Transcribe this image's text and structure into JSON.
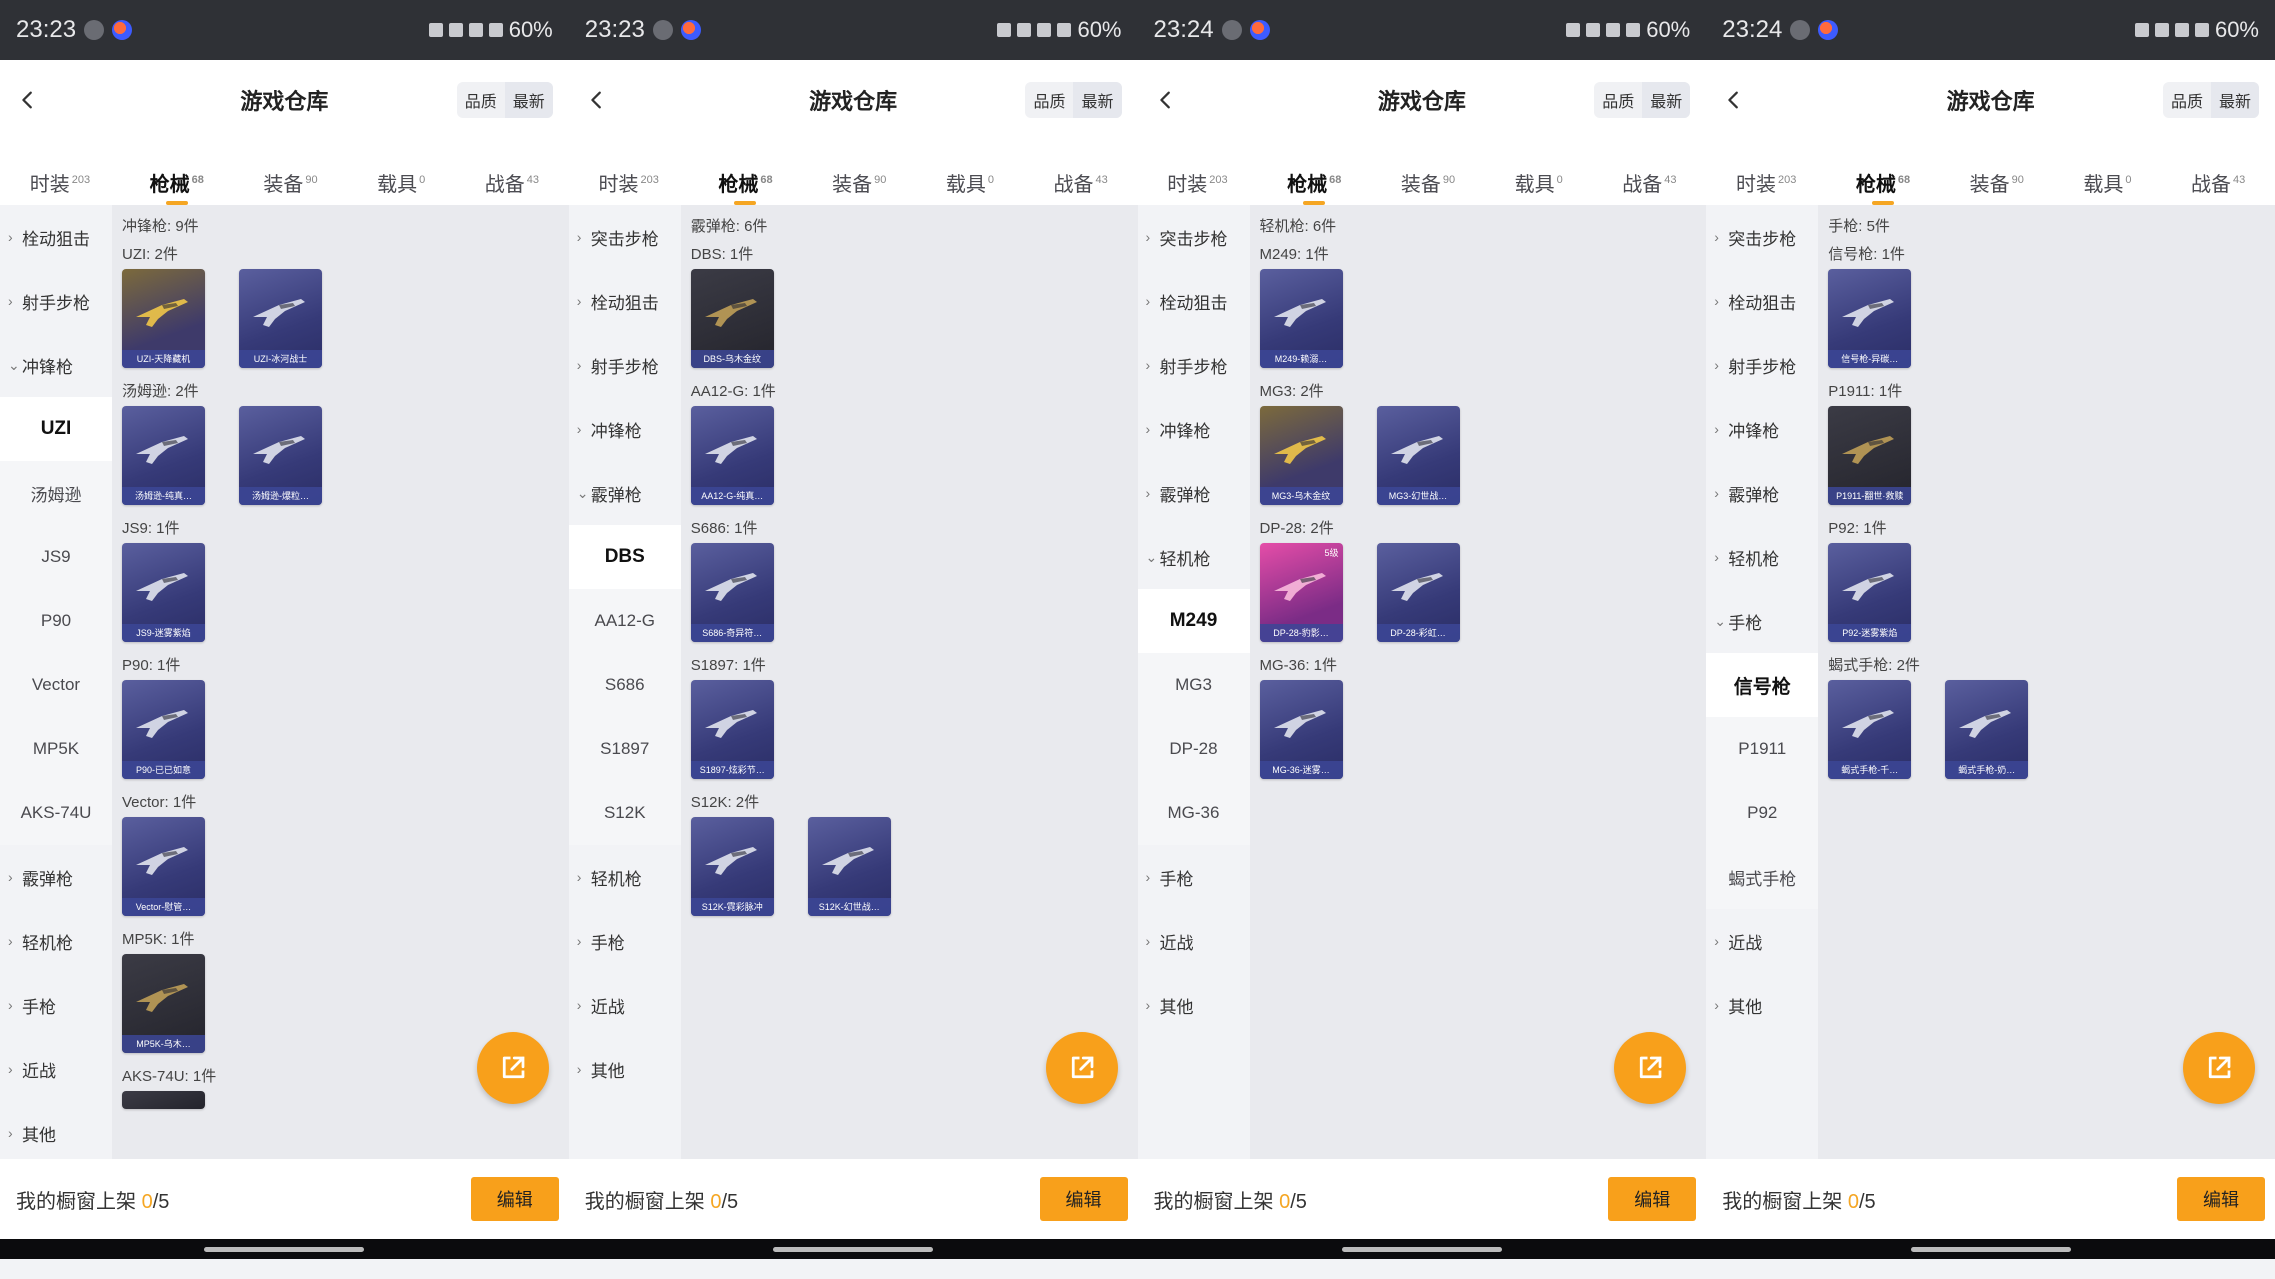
{
  "screens": [
    {
      "status": {
        "time": "23:23",
        "battery": "60%"
      },
      "header": {
        "title": "游戏仓库",
        "quality": "品质",
        "latest": "最新"
      },
      "tabs": [
        {
          "label": "时装",
          "count": "203",
          "active": false
        },
        {
          "label": "枪械",
          "count": "68",
          "active": true
        },
        {
          "label": "装备",
          "count": "90",
          "active": false
        },
        {
          "label": "载具",
          "count": "0",
          "active": false
        },
        {
          "label": "战备",
          "count": "43",
          "active": false
        }
      ],
      "sidebar": [
        {
          "label": "栓动狙击",
          "type": "cat",
          "chev": "›"
        },
        {
          "label": "射手步枪",
          "type": "cat",
          "chev": "›"
        },
        {
          "label": "冲锋枪",
          "type": "cat",
          "chev": "⌄"
        },
        {
          "label": "UZI",
          "type": "sub",
          "selected": true
        },
        {
          "label": "汤姆逊",
          "type": "sub"
        },
        {
          "label": "JS9",
          "type": "sub"
        },
        {
          "label": "P90",
          "type": "sub"
        },
        {
          "label": "Vector",
          "type": "sub"
        },
        {
          "label": "MP5K",
          "type": "sub"
        },
        {
          "label": "AKS-74U",
          "type": "sub"
        },
        {
          "label": "霰弹枪",
          "type": "cat",
          "chev": "›"
        },
        {
          "label": "轻机枪",
          "type": "cat",
          "chev": "›"
        },
        {
          "label": "手枪",
          "type": "cat",
          "chev": "›"
        },
        {
          "label": "近战",
          "type": "cat",
          "chev": "›"
        },
        {
          "label": "其他",
          "type": "cat",
          "chev": "›"
        }
      ],
      "group_title": "冲锋枪: 9件",
      "subgroups": [
        {
          "title": "UZI: 2件",
          "items": [
            {
              "label": "UZI-天降藏机",
              "style": "gold"
            },
            {
              "label": "UZI-冰河战士",
              "style": "blue"
            }
          ]
        },
        {
          "title": "汤姆逊: 2件",
          "items": [
            {
              "label": "汤姆逊-纯真…",
              "style": "blue"
            },
            {
              "label": "汤姆逊-爆粒…",
              "style": "blue"
            }
          ]
        },
        {
          "title": "JS9: 1件",
          "items": [
            {
              "label": "JS9-迷雾紫焰",
              "style": "blue"
            }
          ]
        },
        {
          "title": "P90: 1件",
          "items": [
            {
              "label": "P90-已已如意",
              "style": "blue"
            }
          ]
        },
        {
          "title": "Vector: 1件",
          "items": [
            {
              "label": "Vector-慰管…",
              "style": "blue"
            }
          ]
        },
        {
          "title": "MP5K: 1件",
          "items": [
            {
              "label": "MP5K-乌木…",
              "style": "dark"
            }
          ]
        },
        {
          "title": "AKS-74U: 1件",
          "items": [
            {
              "label": "",
              "style": "dark",
              "partial": true
            }
          ]
        }
      ],
      "footer": {
        "showcase_label": "我的橱窗上架",
        "current": "0",
        "total": "/5",
        "edit": "编辑"
      }
    },
    {
      "status": {
        "time": "23:23",
        "battery": "60%"
      },
      "header": {
        "title": "游戏仓库",
        "quality": "品质",
        "latest": "最新"
      },
      "tabs": [
        {
          "label": "时装",
          "count": "203",
          "active": false
        },
        {
          "label": "枪械",
          "count": "68",
          "active": true
        },
        {
          "label": "装备",
          "count": "90",
          "active": false
        },
        {
          "label": "载具",
          "count": "0",
          "active": false
        },
        {
          "label": "战备",
          "count": "43",
          "active": false
        }
      ],
      "sidebar": [
        {
          "label": "突击步枪",
          "type": "cat",
          "chev": "›"
        },
        {
          "label": "栓动狙击",
          "type": "cat",
          "chev": "›"
        },
        {
          "label": "射手步枪",
          "type": "cat",
          "chev": "›"
        },
        {
          "label": "冲锋枪",
          "type": "cat",
          "chev": "›"
        },
        {
          "label": "霰弹枪",
          "type": "cat",
          "chev": "⌄"
        },
        {
          "label": "DBS",
          "type": "sub",
          "selected": true
        },
        {
          "label": "AA12-G",
          "type": "sub"
        },
        {
          "label": "S686",
          "type": "sub"
        },
        {
          "label": "S1897",
          "type": "sub"
        },
        {
          "label": "S12K",
          "type": "sub"
        },
        {
          "label": "轻机枪",
          "type": "cat",
          "chev": "›"
        },
        {
          "label": "手枪",
          "type": "cat",
          "chev": "›"
        },
        {
          "label": "近战",
          "type": "cat",
          "chev": "›"
        },
        {
          "label": "其他",
          "type": "cat",
          "chev": "›"
        }
      ],
      "group_title": "霰弹枪: 6件",
      "subgroups": [
        {
          "title": "DBS: 1件",
          "items": [
            {
              "label": "DBS-乌木金纹",
              "style": "dark"
            }
          ]
        },
        {
          "title": "AA12-G: 1件",
          "items": [
            {
              "label": "AA12-G-纯真…",
              "style": "blue"
            }
          ]
        },
        {
          "title": "S686: 1件",
          "items": [
            {
              "label": "S686-奇异符…",
              "style": "blue"
            }
          ]
        },
        {
          "title": "S1897: 1件",
          "items": [
            {
              "label": "S1897-炫彩节…",
              "style": "blue"
            }
          ]
        },
        {
          "title": "S12K: 2件",
          "items": [
            {
              "label": "S12K-霓彩脉冲",
              "style": "blue"
            },
            {
              "label": "S12K-幻世战…",
              "style": "blue"
            }
          ]
        }
      ],
      "footer": {
        "showcase_label": "我的橱窗上架",
        "current": "0",
        "total": "/5",
        "edit": "编辑"
      }
    },
    {
      "status": {
        "time": "23:24",
        "battery": "60%"
      },
      "header": {
        "title": "游戏仓库",
        "quality": "品质",
        "latest": "最新"
      },
      "tabs": [
        {
          "label": "时装",
          "count": "203",
          "active": false
        },
        {
          "label": "枪械",
          "count": "68",
          "active": true
        },
        {
          "label": "装备",
          "count": "90",
          "active": false
        },
        {
          "label": "载具",
          "count": "0",
          "active": false
        },
        {
          "label": "战备",
          "count": "43",
          "active": false
        }
      ],
      "sidebar": [
        {
          "label": "突击步枪",
          "type": "cat",
          "chev": "›"
        },
        {
          "label": "栓动狙击",
          "type": "cat",
          "chev": "›"
        },
        {
          "label": "射手步枪",
          "type": "cat",
          "chev": "›"
        },
        {
          "label": "冲锋枪",
          "type": "cat",
          "chev": "›"
        },
        {
          "label": "霰弹枪",
          "type": "cat",
          "chev": "›"
        },
        {
          "label": "轻机枪",
          "type": "cat",
          "chev": "⌄"
        },
        {
          "label": "M249",
          "type": "sub",
          "selected": true
        },
        {
          "label": "MG3",
          "type": "sub"
        },
        {
          "label": "DP-28",
          "type": "sub"
        },
        {
          "label": "MG-36",
          "type": "sub"
        },
        {
          "label": "手枪",
          "type": "cat",
          "chev": "›"
        },
        {
          "label": "近战",
          "type": "cat",
          "chev": "›"
        },
        {
          "label": "其他",
          "type": "cat",
          "chev": "›"
        }
      ],
      "group_title": "轻机枪: 6件",
      "subgroups": [
        {
          "title": "M249: 1件",
          "items": [
            {
              "label": "M249-赖溺…",
              "style": "blue"
            }
          ]
        },
        {
          "title": "MG3: 2件",
          "items": [
            {
              "label": "MG3-乌木金纹",
              "style": "gold"
            },
            {
              "label": "MG3-幻世战…",
              "style": "blue"
            }
          ]
        },
        {
          "title": "DP-28: 2件",
          "items": [
            {
              "label": "DP-28-豹影…",
              "style": "pink",
              "lvl": "5级"
            },
            {
              "label": "DP-28-彩虹…",
              "style": "blue"
            }
          ]
        },
        {
          "title": "MG-36: 1件",
          "items": [
            {
              "label": "MG-36-迷雾…",
              "style": "blue"
            }
          ]
        }
      ],
      "footer": {
        "showcase_label": "我的橱窗上架",
        "current": "0",
        "total": "/5",
        "edit": "编辑"
      }
    },
    {
      "status": {
        "time": "23:24",
        "battery": "60%"
      },
      "header": {
        "title": "游戏仓库",
        "quality": "品质",
        "latest": "最新"
      },
      "tabs": [
        {
          "label": "时装",
          "count": "203",
          "active": false
        },
        {
          "label": "枪械",
          "count": "68",
          "active": true
        },
        {
          "label": "装备",
          "count": "90",
          "active": false
        },
        {
          "label": "载具",
          "count": "0",
          "active": false
        },
        {
          "label": "战备",
          "count": "43",
          "active": false
        }
      ],
      "sidebar": [
        {
          "label": "突击步枪",
          "type": "cat",
          "chev": "›"
        },
        {
          "label": "栓动狙击",
          "type": "cat",
          "chev": "›"
        },
        {
          "label": "射手步枪",
          "type": "cat",
          "chev": "›"
        },
        {
          "label": "冲锋枪",
          "type": "cat",
          "chev": "›"
        },
        {
          "label": "霰弹枪",
          "type": "cat",
          "chev": "›"
        },
        {
          "label": "轻机枪",
          "type": "cat",
          "chev": "›"
        },
        {
          "label": "手枪",
          "type": "cat",
          "chev": "⌄"
        },
        {
          "label": "信号枪",
          "type": "sub",
          "selected": true
        },
        {
          "label": "P1911",
          "type": "sub"
        },
        {
          "label": "P92",
          "type": "sub"
        },
        {
          "label": "蝎式手枪",
          "type": "sub"
        },
        {
          "label": "近战",
          "type": "cat",
          "chev": "›"
        },
        {
          "label": "其他",
          "type": "cat",
          "chev": "›"
        }
      ],
      "group_title": "手枪: 5件",
      "subgroups": [
        {
          "title": "信号枪: 1件",
          "items": [
            {
              "label": "信号枪-异碳…",
              "style": "blue"
            }
          ]
        },
        {
          "title": "P1911: 1件",
          "items": [
            {
              "label": "P1911-翻世·救赎",
              "style": "dark"
            }
          ]
        },
        {
          "title": "P92: 1件",
          "items": [
            {
              "label": "P92-迷雾紫焰",
              "style": "blue"
            }
          ]
        },
        {
          "title": "蝎式手枪: 2件",
          "items": [
            {
              "label": "蝎式手枪-千…",
              "style": "blue"
            },
            {
              "label": "蝎式手枪-奶…",
              "style": "blue"
            }
          ]
        }
      ],
      "footer": {
        "showcase_label": "我的橱窗上架",
        "current": "0",
        "total": "/5",
        "edit": "编辑"
      }
    }
  ],
  "colors": {
    "accent": "#f8a01b",
    "tab_indicator": "#f5a623"
  },
  "icons": {
    "back": "chevron-left-icon",
    "fab": "share-external-icon"
  }
}
